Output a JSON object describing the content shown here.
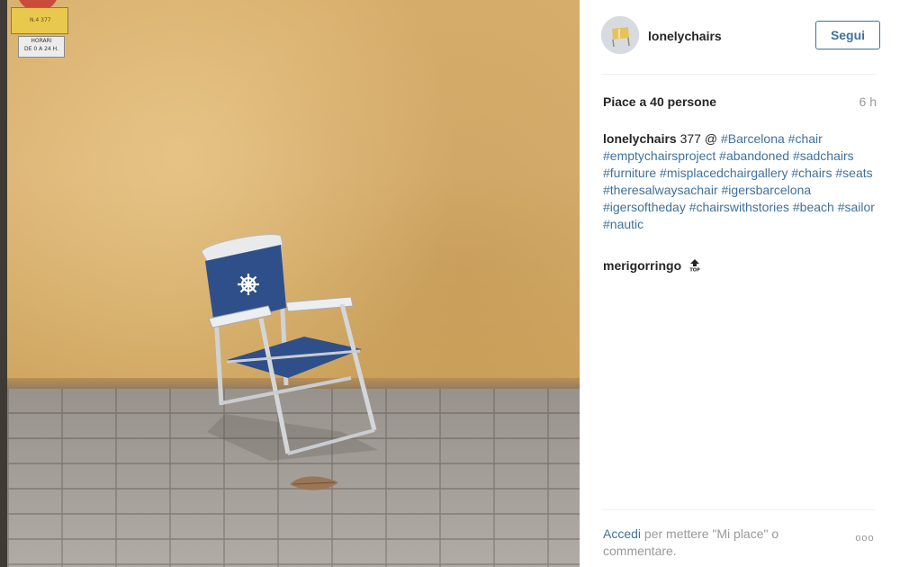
{
  "photo": {
    "sign_top_text": "N.4 377",
    "sign_horari_line1": "HORARI",
    "sign_horari_line2": "DE 0 A 24 H."
  },
  "header": {
    "username": "lonelychairs",
    "follow_label": "Segui"
  },
  "post": {
    "likes": "Piace a 40 persone",
    "time": "6 h",
    "caption": {
      "username": "lonelychairs",
      "text_prefix": "377 @",
      "hashtags": [
        "#Barcelona",
        "#chair",
        "#emptychairsproject",
        "#abandoned",
        "#sadchairs",
        "#furniture",
        "#misplacedchairgallery",
        "#chairs",
        "#seats",
        "#theresalwaysachair",
        "#igersbarcelona",
        "#igersoftheday",
        "#chairswithstories",
        "#beach",
        "#sailor",
        "#nautic"
      ]
    },
    "comment": {
      "username": "merigorringo",
      "emoji": "top-arrow-emoji"
    }
  },
  "footer": {
    "login_link": "Accedi",
    "login_text": "per mettere \"Mi place\" o commentare.",
    "more_label": "ooo"
  },
  "colors": {
    "link": "#3f729b",
    "text": "#262626",
    "muted": "#999999"
  }
}
